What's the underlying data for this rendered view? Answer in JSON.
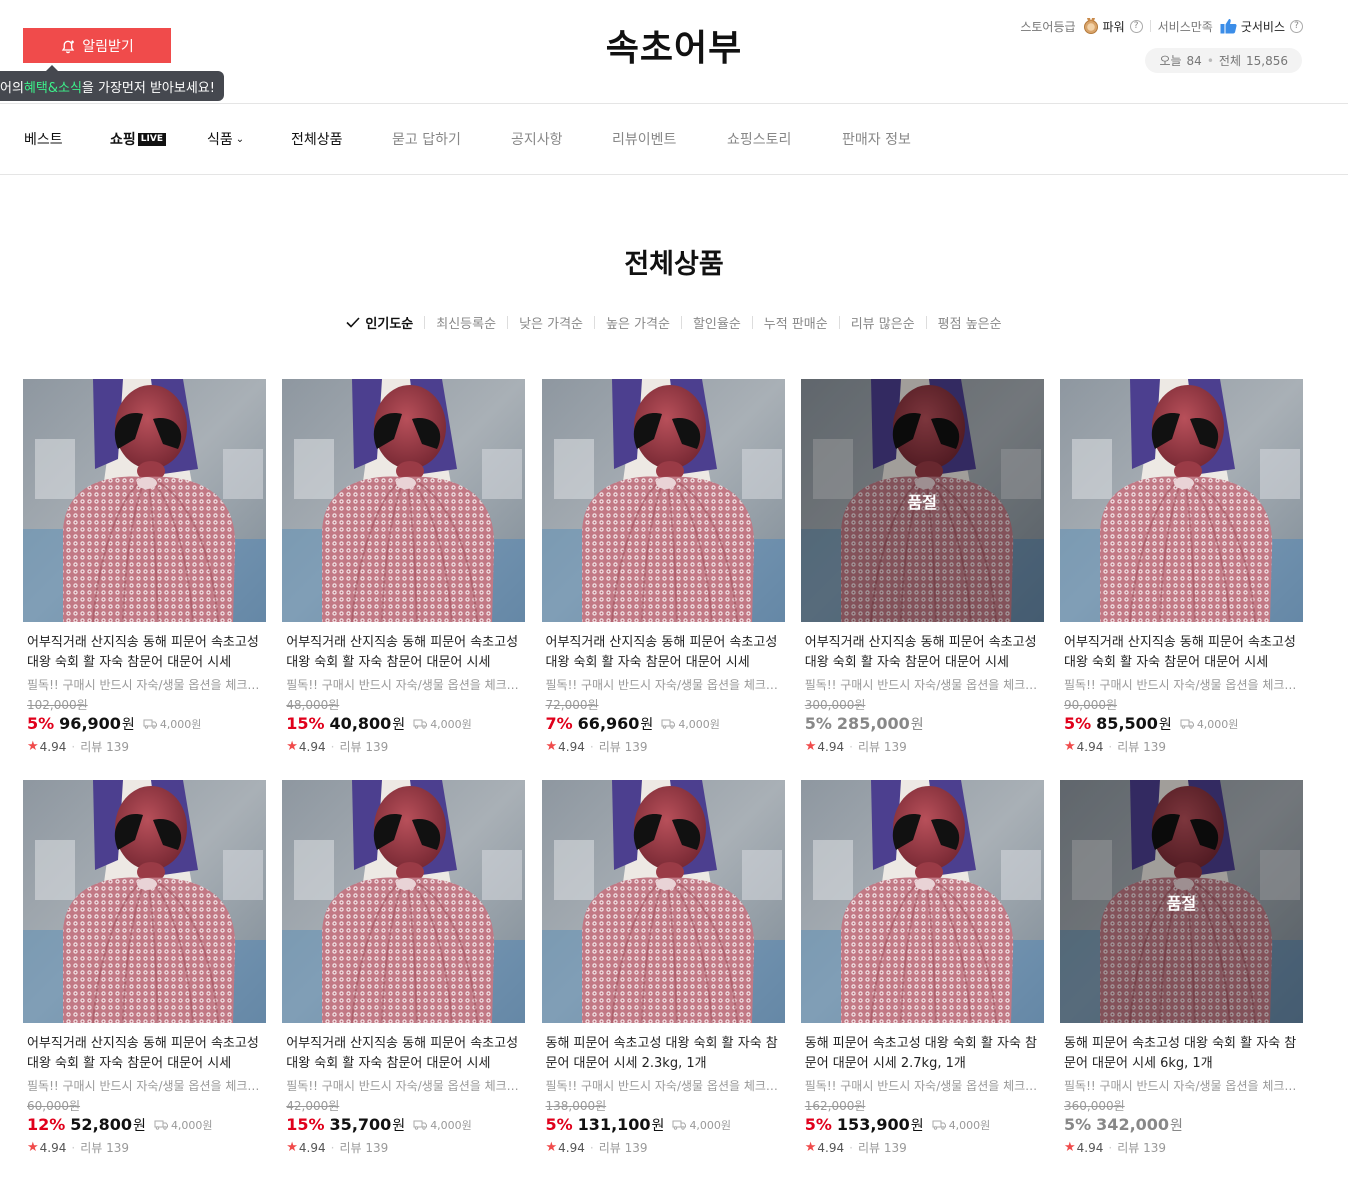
{
  "header": {
    "notify_label": "알림받기",
    "tooltip_pre": "어의 ",
    "tooltip_highlight": "혜택&소식",
    "tooltip_post": "을 가장먼저 받아보세요!",
    "store_name": "속초어부",
    "grade_label": "스토어등급",
    "grade_value": "파워",
    "service_label": "서비스만족",
    "service_value": "굿서비스",
    "visitor_today_label": "오늘",
    "visitor_today": "84",
    "visitor_total_label": "전체",
    "visitor_total": "15,856"
  },
  "nav": {
    "items": [
      "베스트",
      "쇼핑",
      "식품",
      "전체상품",
      "묻고 답하기",
      "공지사항",
      "리뷰이벤트",
      "쇼핑스토리",
      "판매자 정보"
    ],
    "live_badge": "LIVE"
  },
  "section": {
    "title": "전체상품",
    "sort_options": [
      "인기도순",
      "최신등록순",
      "낮은 가격순",
      "높은 가격순",
      "할인율순",
      "누적 판매순",
      "리뷰 많은순",
      "평점 높은순"
    ],
    "active_sort": "인기도순"
  },
  "soldout_label": "품절",
  "won_unit": "원",
  "review_label": "리뷰",
  "products": [
    {
      "name": "어부직거래 산지직송 동해 피문어 속초고성 대왕 숙회 활 자숙 참문어 대문어 시세",
      "desc": "필독!! 구매시 반드시 자숙/생물 옵션을 체크해주세요",
      "orig": "102,000원",
      "rate": "5%",
      "price": "96,900",
      "ship": "4,000원",
      "rating": "4.94",
      "reviews": "139",
      "soldout": false
    },
    {
      "name": "어부직거래 산지직송 동해 피문어 속초고성 대왕 숙회 활 자숙 참문어 대문어 시세",
      "desc": "필독!! 구매시 반드시 자숙/생물 옵션을 체크해주세요",
      "orig": "48,000원",
      "rate": "15%",
      "price": "40,800",
      "ship": "4,000원",
      "rating": "4.94",
      "reviews": "139",
      "soldout": false
    },
    {
      "name": "어부직거래 산지직송 동해 피문어 속초고성 대왕 숙회 활 자숙 참문어 대문어 시세",
      "desc": "필독!! 구매시 반드시 자숙/생물 옵션을 체크해주세요",
      "orig": "72,000원",
      "rate": "7%",
      "price": "66,960",
      "ship": "4,000원",
      "rating": "4.94",
      "reviews": "139",
      "soldout": false
    },
    {
      "name": "어부직거래 산지직송 동해 피문어 속초고성 대왕 숙회 활 자숙 참문어 대문어 시세",
      "desc": "필독!! 구매시 반드시 자숙/생물 옵션을 체크해주세요",
      "orig": "300,000원",
      "rate": "5%",
      "price": "285,000",
      "ship": "",
      "rating": "4.94",
      "reviews": "139",
      "soldout": true
    },
    {
      "name": "어부직거래 산지직송 동해 피문어 속초고성 대왕 숙회 활 자숙 참문어 대문어 시세",
      "desc": "필독!! 구매시 반드시 자숙/생물 옵션을 체크해주세요",
      "orig": "90,000원",
      "rate": "5%",
      "price": "85,500",
      "ship": "4,000원",
      "rating": "4.94",
      "reviews": "139",
      "soldout": false
    },
    {
      "name": "어부직거래 산지직송 동해 피문어 속초고성 대왕 숙회 활 자숙 참문어 대문어 시세",
      "desc": "필독!! 구매시 반드시 자숙/생물 옵션을 체크해주세요",
      "orig": "60,000원",
      "rate": "12%",
      "price": "52,800",
      "ship": "4,000원",
      "rating": "4.94",
      "reviews": "139",
      "soldout": false
    },
    {
      "name": "어부직거래 산지직송 동해 피문어 속초고성 대왕 숙회 활 자숙 참문어 대문어 시세",
      "desc": "필독!! 구매시 반드시 자숙/생물 옵션을 체크해주세요",
      "orig": "42,000원",
      "rate": "15%",
      "price": "35,700",
      "ship": "4,000원",
      "rating": "4.94",
      "reviews": "139",
      "soldout": false
    },
    {
      "name": "동해 피문어 속초고성 대왕 숙회 활 자숙 참문어 대문어 시세 2.3kg, 1개",
      "desc": "필독!! 구매시 반드시 자숙/생물 옵션을 체크해주세요",
      "orig": "138,000원",
      "rate": "5%",
      "price": "131,100",
      "ship": "4,000원",
      "rating": "4.94",
      "reviews": "139",
      "soldout": false
    },
    {
      "name": "동해 피문어 속초고성 대왕 숙회 활 자숙 참문어 대문어 시세 2.7kg, 1개",
      "desc": "필독!! 구매시 반드시 자숙/생물 옵션을 체크해주세요",
      "orig": "162,000원",
      "rate": "5%",
      "price": "153,900",
      "ship": "4,000원",
      "rating": "4.94",
      "reviews": "139",
      "soldout": false
    },
    {
      "name": "동해 피문어 속초고성 대왕 숙회 활 자숙 참문어 대문어 시세 6kg, 1개",
      "desc": "필독!! 구매시 반드시 자숙/생물 옵션을 체크해주세요",
      "orig": "360,000원",
      "rate": "5%",
      "price": "342,000",
      "ship": "",
      "rating": "4.94",
      "reviews": "139",
      "soldout": true
    }
  ],
  "colors": {
    "accent_red": "#f04b4b",
    "discount_red": "#e0001b",
    "tooltip_bg": "#45484f",
    "tooltip_highlight": "#3cf08a"
  }
}
